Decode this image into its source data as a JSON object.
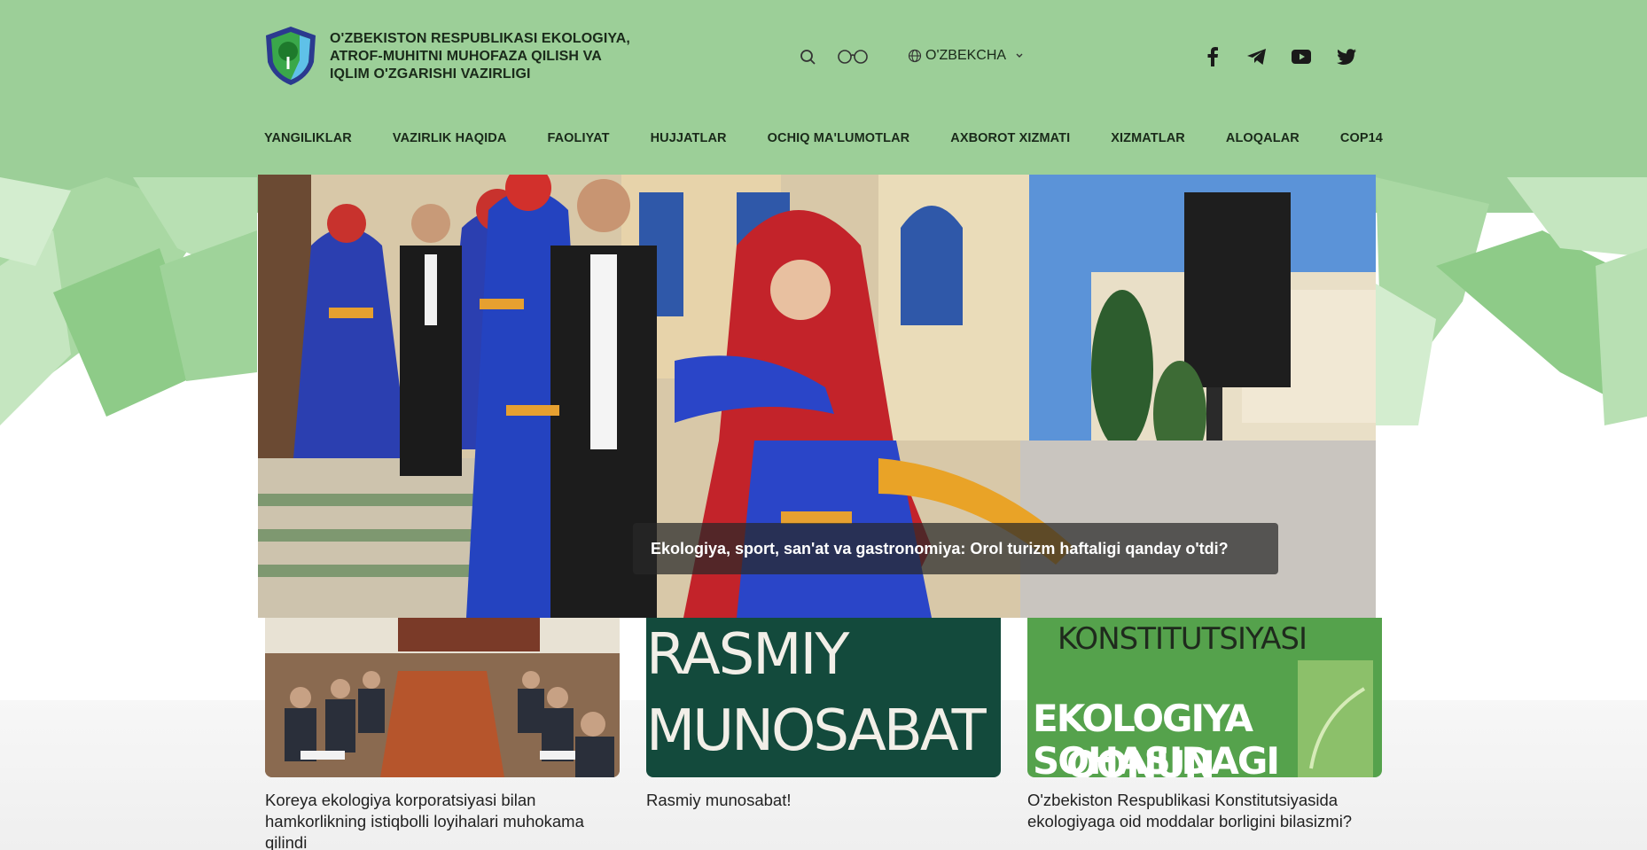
{
  "header": {
    "org_name_lines": [
      "O'ZBEKISTON RESPUBLIKASI EKOLOGIYA,",
      "ATROF-MUHITNI MUHOFAZA QILISH VA",
      "IQLIM O'ZGARISHI VAZIRLIGI"
    ],
    "language": "O'ZBEKCHA",
    "icons": {
      "search": "search-icon",
      "accessibility": "glasses-icon",
      "globe": "globe-icon",
      "facebook": "facebook-icon",
      "telegram": "telegram-icon",
      "youtube": "youtube-icon",
      "twitter": "twitter-icon"
    }
  },
  "nav": [
    "YANGILIKLAR",
    "VAZIRLIK HAQIDA",
    "FAOLIYAT",
    "HUJJATLAR",
    "OCHIQ MA'LUMOTLAR",
    "AXBOROT XIZMATI",
    "XIZMATLAR",
    "ALOQALAR",
    "COP14"
  ],
  "hero": {
    "caption": "Ekologiya, sport, san'at va gastronomiya: Orol turizm haftaligi qanday o'tdi?"
  },
  "cards": [
    {
      "title": "Koreya ekologiya korporatsiyasi bilan hamkorlikning istiqbolli loyihalari muhokama qilindi"
    },
    {
      "title": "Rasmiy munosabat!",
      "thumb_lines": [
        "RASMIY",
        "MUNOSABAT"
      ]
    },
    {
      "title": "O'zbekiston Respublikasi Konstitutsiyasida ekologiyaga oid moddalar borligini bilasizmi?",
      "thumb_lines": [
        "KONSTITUTSIYASI",
        "EKOLOGIYA SOHASIDAGI",
        "QONUN MODDALARI"
      ]
    }
  ],
  "colors": {
    "header_bg": "#9ccf98",
    "dark_green": "#134a3c",
    "bright_green": "#55a24c"
  }
}
